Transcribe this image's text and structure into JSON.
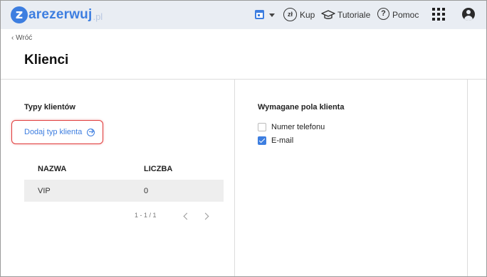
{
  "topbar": {
    "logo_letter": "z",
    "logo_word": "arezerwuj",
    "logo_tld": ".pl",
    "buy_icon_text": "zł",
    "buy_label": "Kup",
    "tutorials_label": "Tutoriale",
    "help_icon_text": "?",
    "help_label": "Pomoc",
    "accent_color": "#3d7ee0"
  },
  "header": {
    "back_label": "‹ Wróć",
    "title": "Klienci"
  },
  "client_types": {
    "section_title": "Typy klientów",
    "add_button_label": "Dodaj typ klienta",
    "table": {
      "columns": [
        "NAZWA",
        "LICZBA"
      ],
      "rows": [
        {
          "name": "VIP",
          "count": "0"
        }
      ]
    },
    "pagination": "1 - 1 / 1"
  },
  "required_fields": {
    "section_title": "Wymagane pola klienta",
    "fields": [
      {
        "label": "Numer telefonu",
        "checked": false
      },
      {
        "label": "E-mail",
        "checked": true
      }
    ]
  },
  "icons": [
    "calendar-icon",
    "chevron-down-icon",
    "zloty-icon",
    "graduation-cap-icon",
    "help-icon",
    "apps-grid-icon",
    "avatar-icon",
    "add-circle-arrow-icon",
    "chevron-left-icon",
    "chevron-right-icon"
  ]
}
